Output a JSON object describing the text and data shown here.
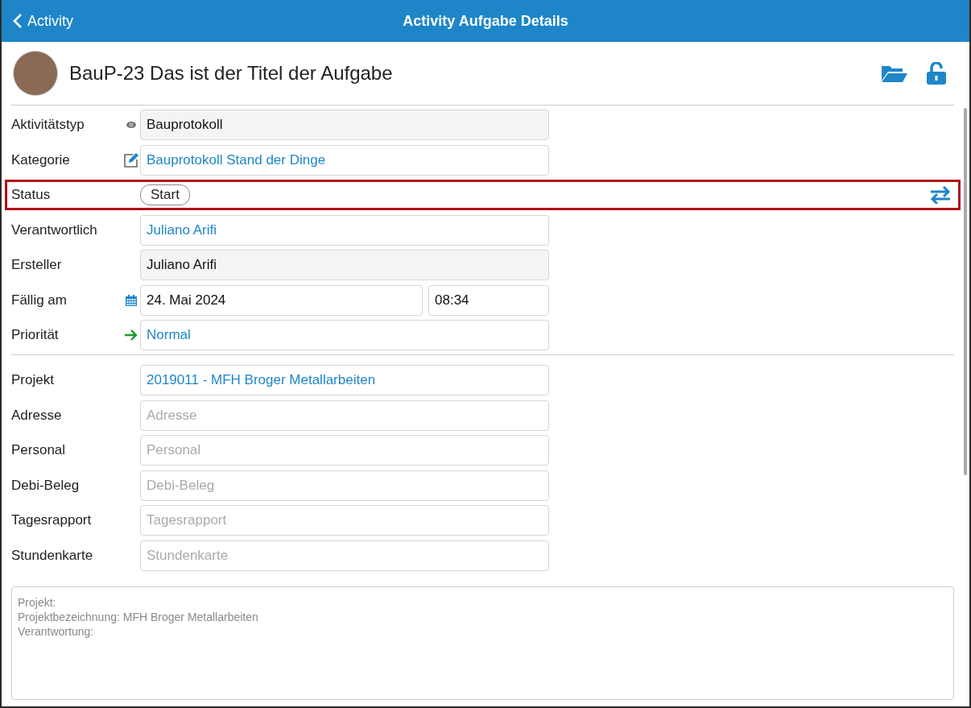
{
  "nav": {
    "back": "Activity",
    "title": "Activity Aufgabe Details"
  },
  "task": {
    "title": "BauP-23 Das ist der Titel der Aufgabe"
  },
  "fields": [
    {
      "kind": "type",
      "label": "Aktivitätstyp",
      "value": "Bauprotokoll"
    },
    {
      "kind": "category",
      "label": "Kategorie",
      "value": "Bauprotokoll Stand der Dinge"
    },
    {
      "kind": "status",
      "label": "Status",
      "value": "Start",
      "highlighted": true
    },
    {
      "kind": "person",
      "label": "Verantwortlich",
      "value": "Juliano Arifi"
    },
    {
      "kind": "creator",
      "label": "Ersteller",
      "value": "Juliano Arifi"
    },
    {
      "kind": "due",
      "label": "Fällig am",
      "value": "24. Mai 2024",
      "time": "08:34"
    },
    {
      "kind": "priority",
      "label": "Priorität",
      "value": "Normal"
    }
  ],
  "links": [
    {
      "label": "Projekt",
      "value": "2019011 - MFH Broger Metallarbeiten"
    },
    {
      "label": "Adresse",
      "placeholder": "Adresse"
    },
    {
      "label": "Personal",
      "placeholder": "Personal"
    },
    {
      "label": "Debi-Beleg",
      "placeholder": "Debi-Beleg"
    },
    {
      "label": "Tagesrapport",
      "placeholder": "Tagesrapport"
    },
    {
      "label": "Stundenkarte",
      "placeholder": "Stundenkarte"
    }
  ],
  "notes": [
    "Projekt:",
    "Projektbezeichnung: MFH Broger Metallarbeiten",
    "Verantwortung:"
  ]
}
